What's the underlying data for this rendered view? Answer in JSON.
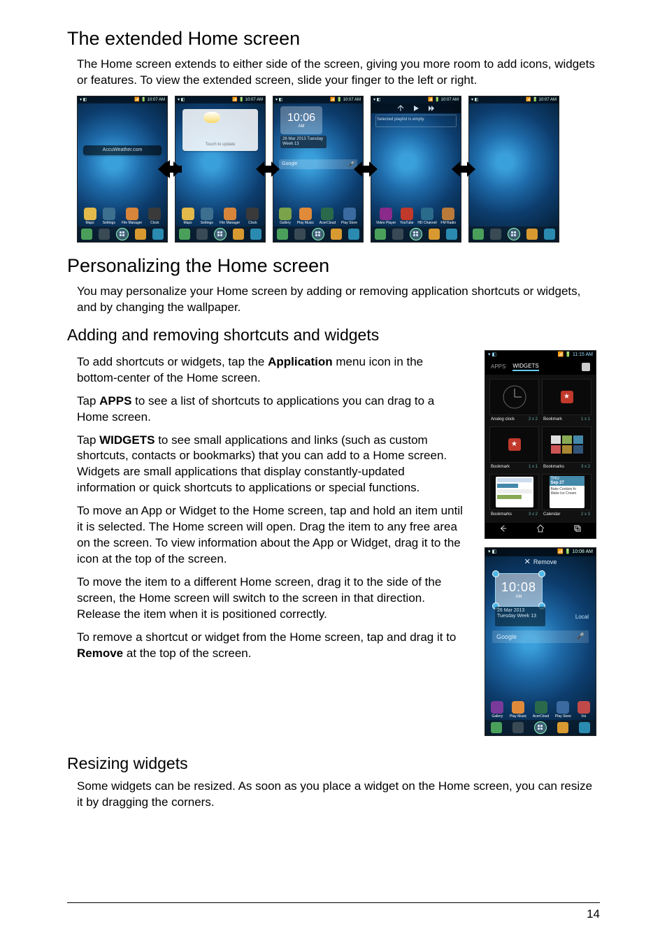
{
  "page_number": "14",
  "sections": {
    "extended": {
      "heading": "The extended Home screen",
      "p1": "The Home screen extends to either side of the screen, giving you more room to add icons, widgets or features. To view the extended screen, slide your finger to the left or right."
    },
    "personalizing": {
      "heading": "Personalizing the Home screen",
      "p1": "You may personalize your Home screen by adding or removing application shortcuts or widgets, and by changing the wallpaper."
    },
    "adding": {
      "heading": "Adding and removing shortcuts and widgets",
      "p1a": "To add shortcuts or widgets, tap the ",
      "p1b_bold": "Application",
      "p1c": " menu icon in the bottom-center of the Home screen.",
      "p2a": "Tap ",
      "p2b_bold": "APPS",
      "p2c": " to see a list of shortcuts to applications you can drag to a Home screen.",
      "p3a": "Tap ",
      "p3b_bold": "WIDGETS",
      "p3c": " to see small applications and links (such as custom shortcuts, contacts or bookmarks) that you can add to a Home screen. Widgets are small applications that display constantly-updated information or quick shortcuts to applications or special functions.",
      "p4": "To move an App or Widget to the Home screen, tap and hold an item until it is selected. The Home screen will open. Drag the item to any free area on the screen. To view information about the App or Widget, drag it to the icon at the top of the screen.",
      "p5": "To move the item to a different Home screen, drag it to the side of the screen, the Home screen will switch to the screen in that direction. Release the item when it is positioned correctly.",
      "p6a": "To remove a shortcut or widget from the Home screen, tap and drag it to ",
      "p6b_bold": "Remove",
      "p6c": " at the top of the screen."
    },
    "resizing": {
      "heading": "Resizing widgets",
      "p1": "Some widgets can be resized. As soon as you place a widget on the Home screen, you can resize it by dragging the corners."
    }
  },
  "phone_row": {
    "status_time": "10:07",
    "status_ampm": "AM",
    "screens": [
      {
        "widget_text": "AccuWeather.com",
        "apps": [
          {
            "label": "Maps",
            "color": "#e2b94a"
          },
          {
            "label": "Settings",
            "color": "#3d6f8f"
          },
          {
            "label": "File Manager",
            "color": "#d7853a"
          },
          {
            "label": "Clock",
            "color": "#3a3a3a"
          }
        ]
      },
      {
        "widget_text": "Touch to update",
        "apps": [
          {
            "label": "Maps",
            "color": "#e2b94a"
          },
          {
            "label": "Settings",
            "color": "#3d6f8f"
          },
          {
            "label": "File Manager",
            "color": "#d7853a"
          },
          {
            "label": "Clock",
            "color": "#3a3a3a"
          }
        ]
      },
      {
        "clock_time": "10:06",
        "clock_ampm": "AM",
        "date_lines": "26 Mar 2013\nTuesday\nWeek 13",
        "search_text": "Google",
        "apps": [
          {
            "label": "Gallery",
            "color": "#7aa34a"
          },
          {
            "label": "Play Music",
            "color": "#e08a3a"
          },
          {
            "label": "AcerCloud",
            "color": "#2a6a4a"
          },
          {
            "label": "Play Store",
            "color": "#3a6aa0"
          }
        ]
      },
      {
        "playlist_text": "Selected playlist is empty.",
        "apps": [
          {
            "label": "Video Player",
            "color": "#8a2a8a"
          },
          {
            "label": "YouTube",
            "color": "#c0392b"
          },
          {
            "label": "HD Channel",
            "color": "#2a6a8a"
          },
          {
            "label": "FM Radio",
            "color": "#b97a3a"
          }
        ]
      },
      {
        "apps": []
      }
    ],
    "dock_colors": [
      "#4aa05a",
      "#3a4a55",
      "#2a3a45",
      "#d89a30",
      "#2a8ab0"
    ]
  },
  "widget_picker": {
    "status_time": "11:15",
    "status_ampm": "AM",
    "tab_apps": "APPS",
    "tab_widgets": "WIDGETS",
    "cells": [
      {
        "name": "Analog clock",
        "dim": "2 x 2"
      },
      {
        "name": "Bookmark",
        "dim": "1 x 1"
      },
      {
        "name": "Bookmark",
        "dim": "1 x 1"
      },
      {
        "name": "Bookmarks",
        "dim": "3 x 2"
      },
      {
        "name": "Bookmarks",
        "dim": "3 x 2"
      },
      {
        "name": "Calendar",
        "dim": "2 x 3"
      }
    ],
    "calendar_date": "Sep 27",
    "calendar_item": "Bake Cookies fo\nMake Ice Cream"
  },
  "remove_phone": {
    "status_time": "10:08",
    "status_ampm": "AM",
    "remove_label": "Remove",
    "clock_time": "10:08",
    "clock_ampm": "AM",
    "date_lines": "26 Mar 2013\nTuesday\nWeek 13",
    "local_label": "Local",
    "search_text": "Google",
    "apps": [
      {
        "label": "Gallery",
        "color": "#7a3a9a"
      },
      {
        "label": "Play Music",
        "color": "#e08a3a"
      },
      {
        "label": "AcerCloud",
        "color": "#2a6a4a"
      },
      {
        "label": "Play Store",
        "color": "#3a6aa0"
      },
      {
        "label": "Voi",
        "color": "#c04a4a"
      }
    ],
    "dock_colors": [
      "#4aa05a",
      "#3a4a55",
      "#2a3a45",
      "#d89a30",
      "#2a8ab0"
    ]
  }
}
